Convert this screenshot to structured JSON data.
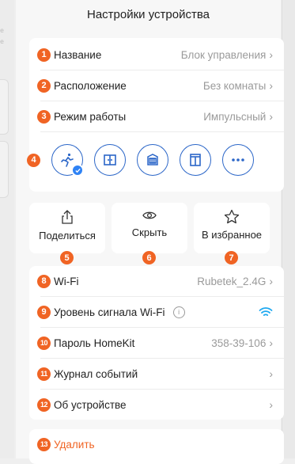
{
  "left_strip": {
    "line1": "e",
    "line2": "e"
  },
  "title": "Настройки устройства",
  "settings": [
    {
      "num": "1",
      "label": "Название",
      "value": "Блок управления"
    },
    {
      "num": "2",
      "label": "Расположение",
      "value": "Без комнаты"
    },
    {
      "num": "3",
      "label": "Режим работы",
      "value": "Импульсный"
    }
  ],
  "modes": {
    "num": "4",
    "items": [
      "run-icon",
      "double-door-icon",
      "garage-icon",
      "wardrobe-icon",
      "more-icon"
    ]
  },
  "actions": [
    {
      "num": "5",
      "label": "Поделиться",
      "icon": "share-icon"
    },
    {
      "num": "6",
      "label": "Скрыть",
      "icon": "eye-icon"
    },
    {
      "num": "7",
      "label": "В избранное",
      "icon": "star-icon"
    }
  ],
  "network": [
    {
      "num": "8",
      "label": "Wi-Fi",
      "value": "Rubetek_2.4G"
    },
    {
      "num": "9",
      "label": "Уровень сигнала Wi-Fi",
      "value": ""
    },
    {
      "num": "10",
      "label": "Пароль HomeKit",
      "value": "358-39-106"
    },
    {
      "num": "11",
      "label": "Журнал событий",
      "value": ""
    },
    {
      "num": "12",
      "label": "Об устройстве",
      "value": ""
    }
  ],
  "delete": {
    "num": "13",
    "label": "Удалить"
  },
  "colors": {
    "accent": "#f06424",
    "blue": "#2b66c8",
    "wifi": "#1ea9f0"
  }
}
